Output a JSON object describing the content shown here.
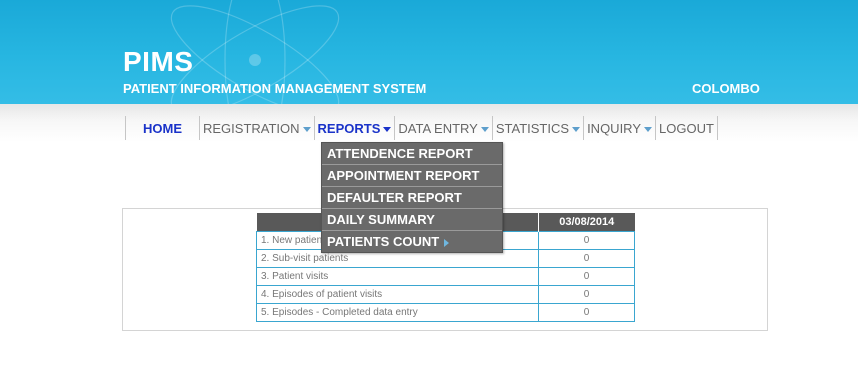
{
  "header": {
    "brand": "PIMS",
    "subtitle": "PATIENT INFORMATION MANAGEMENT SYSTEM",
    "location": "COLOMBO"
  },
  "nav": [
    {
      "label": "HOME",
      "active": false,
      "has_caret": false
    },
    {
      "label": "REGISTRATION",
      "active": false,
      "has_caret": true
    },
    {
      "label": "REPORTS",
      "active": true,
      "has_caret": true
    },
    {
      "label": "DATA ENTRY",
      "active": false,
      "has_caret": true
    },
    {
      "label": "STATISTICS",
      "active": false,
      "has_caret": true
    },
    {
      "label": "INQUIRY",
      "active": false,
      "has_caret": true
    },
    {
      "label": "LOGOUT",
      "active": false,
      "has_caret": false
    }
  ],
  "reports_menu": [
    {
      "label": "ATTENDENCE REPORT",
      "has_submenu": false
    },
    {
      "label": "APPOINTMENT REPORT",
      "has_submenu": false
    },
    {
      "label": "DEFAULTER REPORT",
      "has_submenu": false
    },
    {
      "label": "DAILY SUMMARY",
      "has_submenu": false
    },
    {
      "label": "PATIENTS COUNT",
      "has_submenu": true
    }
  ],
  "summary_table": {
    "date_header": "03/08/2014",
    "rows": [
      {
        "label": "1. New patients",
        "value": "0"
      },
      {
        "label": "2. Sub-visit patients",
        "value": "0"
      },
      {
        "label": "3. Patient visits",
        "value": "0"
      },
      {
        "label": "4. Episodes of patient visits",
        "value": "0"
      },
      {
        "label": "5. Episodes - Completed data entry",
        "value": "0"
      }
    ]
  },
  "colors": {
    "header_blue": "#27b6e1",
    "nav_active": "#1a33c9",
    "dropdown_bg": "#6a6a6a",
    "table_border": "#3aa6d0"
  },
  "icons": {
    "nav_caret": "chevron-down-icon",
    "submenu_arrow": "chevron-right-icon"
  }
}
